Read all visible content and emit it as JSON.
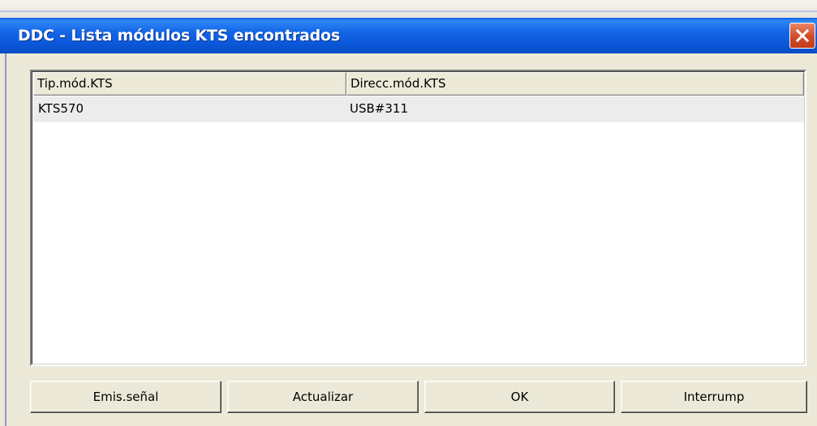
{
  "window": {
    "title": "DDC - Lista módulos KTS encontrados",
    "close_icon": "close-icon"
  },
  "list": {
    "columns": [
      "Tip.mód.KTS",
      "Direcc.mód.KTS"
    ],
    "rows": [
      [
        "KTS570",
        "USB#311"
      ]
    ]
  },
  "buttons": {
    "emit_signal": "Emis.señal",
    "refresh": "Actualizar",
    "ok": "OK",
    "interrupt": "Interrump"
  },
  "colors": {
    "titlebar": "#0a57d9",
    "close_button": "#d24a27",
    "dialog_face": "#ece9d8",
    "selected_row": "#ececec"
  }
}
